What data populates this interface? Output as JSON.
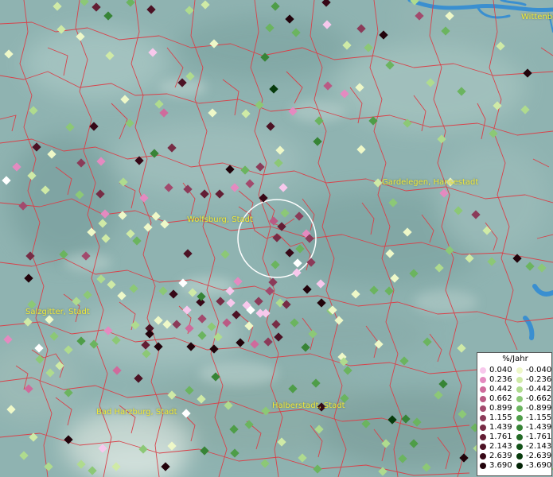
{
  "map": {
    "places": [
      {
        "id": "wittenberge",
        "name": "Wittenbe"
      },
      {
        "id": "gardelegen",
        "name": "Gardelegen, Hansestadt"
      },
      {
        "id": "wolfsburg",
        "name": "Wolfsburg, Stadt"
      },
      {
        "id": "salzgitter",
        "name": "Salzgitter, Stadt"
      },
      {
        "id": "bad-harzburg",
        "name": "Bad Harzburg, Stadt"
      },
      {
        "id": "halberstadt",
        "name": "Halberstadt, Stadt"
      }
    ],
    "colors": {
      "terrain": "#8fb3b1",
      "boundary": "#d8424a",
      "water": "#3a8fd0",
      "place_label": "#f1e93a",
      "selection_ring": "#ffffff"
    },
    "selection_ring": "selected-area-circle"
  },
  "legend": {
    "title": "%/Jahr",
    "positive": [
      {
        "value": "0.040",
        "color": "#f7c8ec"
      },
      {
        "value": "0.236",
        "color": "#e48ac0"
      },
      {
        "value": "0.442",
        "color": "#cf6b9c"
      },
      {
        "value": "0.662",
        "color": "#ba5a84"
      },
      {
        "value": "0.899",
        "color": "#a24a6d"
      },
      {
        "value": "1.155",
        "color": "#8b3b59"
      },
      {
        "value": "1.439",
        "color": "#772c45"
      },
      {
        "value": "1.761",
        "color": "#631e34"
      },
      {
        "value": "2.143",
        "color": "#4c1224"
      },
      {
        "value": "2.639",
        "color": "#370817"
      },
      {
        "value": "3.690",
        "color": "#22030b"
      }
    ],
    "negative": [
      {
        "value": "-0.040",
        "color": "#eef8c8"
      },
      {
        "value": "-0.236",
        "color": "#cfeaa6"
      },
      {
        "value": "-0.442",
        "color": "#afdb8e"
      },
      {
        "value": "-0.662",
        "color": "#8cc876"
      },
      {
        "value": "-0.899",
        "color": "#6bb45f"
      },
      {
        "value": "-1.155",
        "color": "#4e9d48"
      },
      {
        "value": "-1.439",
        "color": "#378436"
      },
      {
        "value": "-1.761",
        "color": "#236a26"
      },
      {
        "value": "-2.143",
        "color": "#125218"
      },
      {
        "value": "-2.639",
        "color": "#073b0c"
      },
      {
        "value": "-3.690",
        "color": "#022305"
      }
    ]
  }
}
